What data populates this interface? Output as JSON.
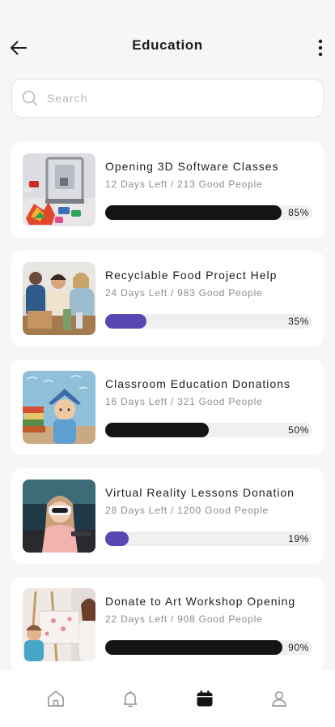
{
  "header": {
    "title": "Education",
    "back_icon": "arrow-left-icon",
    "more_icon": "more-vertical-icon"
  },
  "search": {
    "placeholder": "Search",
    "value": "",
    "icon": "search-icon"
  },
  "campaigns": [
    {
      "title": "Opening 3D Software Classes",
      "days": "12 Days Left",
      "separator": "/",
      "people": "213 Good People",
      "progress": 0.85,
      "progress_label": "85%",
      "bar_color": "#141414",
      "image": "3d-printer-photo"
    },
    {
      "title": "Recyclable Food Project Help",
      "days": "24 Days Left",
      "separator": "/",
      "people": "983 Good People",
      "progress": 0.2,
      "progress_label": "35%",
      "bar_color": "#5747b0",
      "image": "volunteers-photo"
    },
    {
      "title": "Classroom Education Donations",
      "days": "16 Days Left",
      "separator": "/",
      "people": "321 Good People",
      "progress": 0.5,
      "progress_label": "50%",
      "bar_color": "#141414",
      "image": "boy-with-books-photo"
    },
    {
      "title": "Virtual Reality Lessons Donation",
      "days": "28 Days Left",
      "separator": "/",
      "people": "1200 Good People",
      "progress": 0.115,
      "progress_label": "19%",
      "bar_color": "#5747b0",
      "image": "vr-headset-photo"
    },
    {
      "title": "Donate to Art Workshop Opening",
      "days": "22 Days Left",
      "separator": "/",
      "people": "908 Good People",
      "progress": 0.855,
      "progress_label": "90%",
      "bar_color": "#141414",
      "image": "art-workshop-photo"
    }
  ],
  "bottom_nav": {
    "items": [
      {
        "icon": "home-icon",
        "active": false
      },
      {
        "icon": "bell-icon",
        "active": false
      },
      {
        "icon": "calendar-icon",
        "active": true
      },
      {
        "icon": "user-icon",
        "active": false
      }
    ],
    "active_color": "#141414",
    "inactive_color": "#9b9ba0"
  },
  "colors": {
    "background": "#f6f6f7",
    "card": "#ffffff",
    "accent_purple": "#5747b0",
    "bar_dark": "#141414",
    "track": "#f0f0f1"
  }
}
